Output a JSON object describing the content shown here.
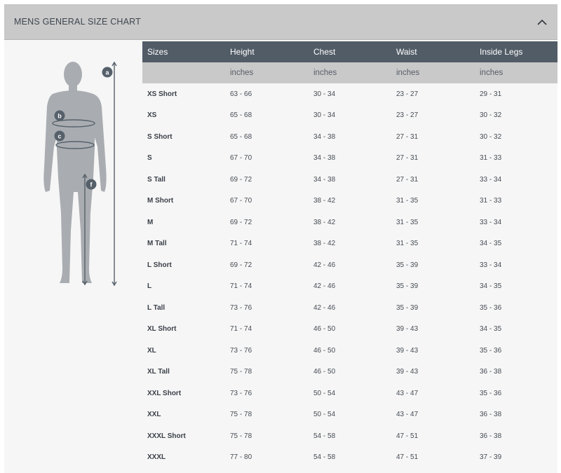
{
  "panel": {
    "title": "MENS GENERAL SIZE CHART",
    "collapse_icon": "chevron-up-icon"
  },
  "figure": {
    "markers": [
      "a",
      "b",
      "c",
      "f"
    ]
  },
  "table": {
    "columns": [
      "Sizes",
      "Height",
      "Chest",
      "Waist",
      "Inside Legs"
    ],
    "units": [
      "",
      "inches",
      "inches",
      "inches",
      "inches"
    ],
    "rows": [
      [
        "XS Short",
        "63 - 66",
        "30 - 34",
        "23 - 27",
        "29 - 31"
      ],
      [
        "XS",
        "65 - 68",
        "30 - 34",
        "23 - 27",
        "30 - 32"
      ],
      [
        "S Short",
        "65 - 68",
        "34 - 38",
        "27 - 31",
        "30 - 32"
      ],
      [
        "S",
        "67 - 70",
        "34 - 38",
        "27 - 31",
        "31 - 33"
      ],
      [
        "S Tall",
        "69 - 72",
        "34 - 38",
        "27 - 31",
        "33 - 34"
      ],
      [
        "M Short",
        "67 - 70",
        "38 - 42",
        "31 - 35",
        "31 - 33"
      ],
      [
        "M",
        "69 - 72",
        "38 - 42",
        "31 - 35",
        "33 - 34"
      ],
      [
        "M Tall",
        "71 - 74",
        "38 - 42",
        "31 - 35",
        "34 - 35"
      ],
      [
        "L Short",
        "69 - 72",
        "42 - 46",
        "35 - 39",
        "33 - 34"
      ],
      [
        "L",
        "71 - 74",
        "42 - 46",
        "35 - 39",
        "34 - 35"
      ],
      [
        "L Tall",
        "73 - 76",
        "42 - 46",
        "35 - 39",
        "35 - 36"
      ],
      [
        "XL Short",
        "71 - 74",
        "46 - 50",
        "39 - 43",
        "34 - 35"
      ],
      [
        "XL",
        "73 - 76",
        "46 - 50",
        "39 - 43",
        "35 - 36"
      ],
      [
        "XL Tall",
        "75 - 78",
        "46 - 50",
        "39 - 43",
        "36 - 38"
      ],
      [
        "XXL Short",
        "73 - 76",
        "50 - 54",
        "43 - 47",
        "35 - 36"
      ],
      [
        "XXL",
        "75 - 78",
        "50 - 54",
        "43 - 47",
        "36 - 38"
      ],
      [
        "XXXL Short",
        "75 - 78",
        "54 - 58",
        "47 - 51",
        "36 - 38"
      ],
      [
        "XXXL",
        "77 - 80",
        "54 - 58",
        "47 - 51",
        "37 - 39"
      ]
    ]
  },
  "colors": {
    "header_bg": "#c9c9c9",
    "table_head_bg": "#525c67",
    "unit_row_bg": "#c9c9c9",
    "panel_bg": "#f6f6f6",
    "figure_fill": "#a9adb1",
    "marker_fill": "#56606a"
  }
}
